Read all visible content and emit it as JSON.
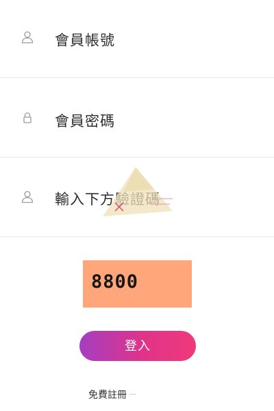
{
  "form": {
    "account_placeholder": "會員帳號",
    "password_placeholder": "會員密碼",
    "captcha_placeholder": "輸入下方驗證碼"
  },
  "icons": {
    "account": "user-icon",
    "password": "lock-icon",
    "captcha": "user-icon"
  },
  "captcha": {
    "code": "8800",
    "background": "#ffa77b"
  },
  "buttons": {
    "login_label": "登入",
    "login_gradient": [
      "#a43fc0",
      "#ef3a7a"
    ]
  },
  "links": {
    "register_label": "免費註冊"
  }
}
